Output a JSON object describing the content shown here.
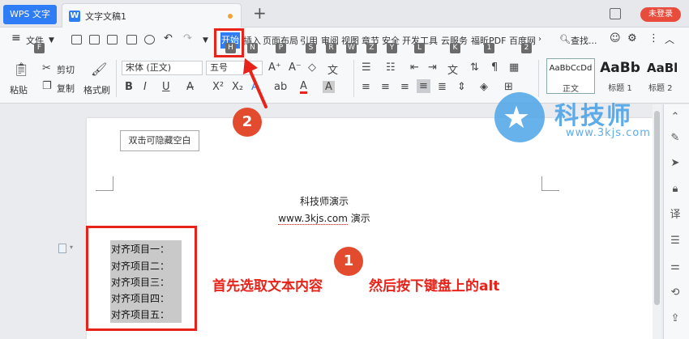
{
  "titlebar": {
    "app_tab": "WPS 文字",
    "doc_tab": "文字文稿1",
    "add_tab": "+",
    "login": "未登录"
  },
  "menu": {
    "file": "文件",
    "file_key": "F",
    "tabs": [
      {
        "label": "开始",
        "key": "H"
      },
      {
        "label": "插入",
        "key": "N"
      },
      {
        "label": "页面布局",
        "key": "P"
      },
      {
        "label": "引用",
        "key": "S"
      },
      {
        "label": "审阅",
        "key": "R"
      },
      {
        "label": "视图",
        "key": "W"
      },
      {
        "label": "章节",
        "key": "Z"
      },
      {
        "label": "安全",
        "key": "Y"
      },
      {
        "label": "开发工具",
        "key": "L"
      },
      {
        "label": "云服务",
        "key": "K"
      },
      {
        "label": "福昕PDF",
        "key": "1"
      },
      {
        "label": "百度网",
        "key": "2"
      }
    ],
    "search": "查找..."
  },
  "ribbon": {
    "paste": "粘贴",
    "cut": "剪切",
    "copy": "复制",
    "format_painter": "格式刷",
    "font_name": "宋体 (正文)",
    "font_size": "五号",
    "bold": "B",
    "italic": "I",
    "underline": "U",
    "styles": [
      {
        "sample": "AaBbCcDd",
        "name": "正文"
      },
      {
        "sample": "AaBb",
        "name": "标题 1"
      },
      {
        "sample": "AaBl",
        "name": "标题 2"
      }
    ]
  },
  "document": {
    "hide_blank": "双击可隐藏空白",
    "title": "科技师演示",
    "url_text": "www.3kjs.com",
    "url_suffix": " 演示",
    "lines": [
      "对齐项目一：",
      "对齐项目二：",
      "对齐项目三：",
      "对齐项目四：",
      "对齐项目五："
    ]
  },
  "annotations": {
    "step1_text": "首先选取文本内容",
    "step1b_text": "然后按下键盘上的alt",
    "badge1": "1",
    "badge2": "2"
  },
  "watermark": {
    "text": "科技师",
    "url": "www.3kjs.com"
  },
  "colors": {
    "accent": "#2e7cf6",
    "annotation_red": "#e8231a",
    "badge": "#e34b2e",
    "watermark": "#4ea4e8"
  }
}
